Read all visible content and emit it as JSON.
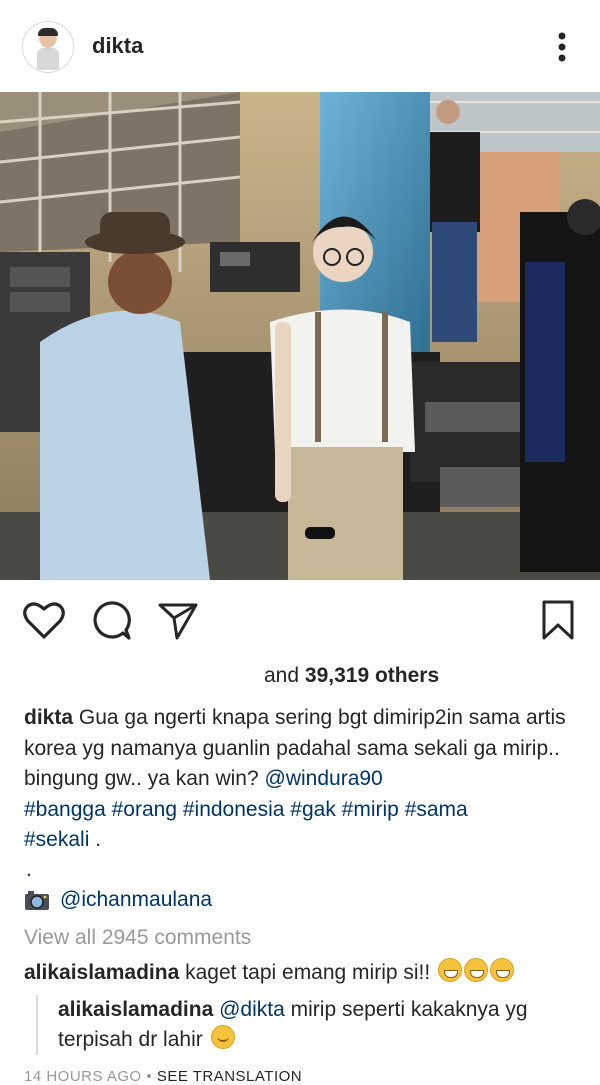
{
  "post": {
    "username": "dikta",
    "likes_prefix": "and",
    "likes_count": "39,319",
    "likes_suffix": "others",
    "caption_user": "dikta",
    "caption_text": "Gua ga ngerti knapa sering bgt dimirip2in sama artis korea yg namanya guanlin padahal sama sekali ga mirip.. bingung gw.. ya kan win?",
    "caption_mention": "@windura90",
    "hashtags": [
      "#bangga",
      "#orang",
      "#indonesia",
      "#gak",
      "#mirip",
      "#sama",
      "#sekali"
    ],
    "caption_end": ".",
    "dot_line": ".",
    "photo_credit": "@ichanmaulana",
    "view_all": "View all 2945 comments",
    "timestamp": "14 HOURS AGO",
    "separator": "•",
    "see_translation": "SEE TRANSLATION"
  },
  "comments": [
    {
      "user": "alikaislamadina",
      "text": "kaget tapi emang mirip si!!",
      "emoji_count": 3
    }
  ],
  "reply": {
    "user": "alikaislamadina",
    "mention": "@dikta",
    "text": "mirip seperti kakaknya yg terpisah dr lahir"
  },
  "icons": {
    "more": "more-vertical-icon",
    "like": "heart-icon",
    "comment": "comment-bubble-icon",
    "share": "paper-plane-icon",
    "save": "bookmark-icon",
    "camera": "camera-emoji-icon"
  },
  "colors": {
    "text": "#262626",
    "link": "#003569",
    "muted": "#999999",
    "divider": "#dbdbdb"
  }
}
